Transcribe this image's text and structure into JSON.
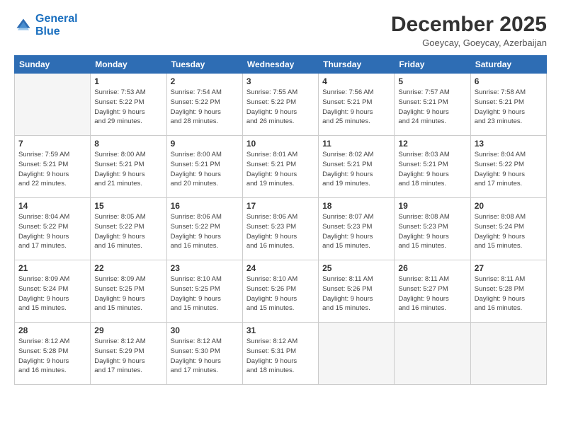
{
  "logo": {
    "line1": "General",
    "line2": "Blue"
  },
  "title": "December 2025",
  "subtitle": "Goeycay, Goeycay, Azerbaijan",
  "headers": [
    "Sunday",
    "Monday",
    "Tuesday",
    "Wednesday",
    "Thursday",
    "Friday",
    "Saturday"
  ],
  "weeks": [
    [
      {
        "day": "",
        "detail": ""
      },
      {
        "day": "1",
        "detail": "Sunrise: 7:53 AM\nSunset: 5:22 PM\nDaylight: 9 hours\nand 29 minutes."
      },
      {
        "day": "2",
        "detail": "Sunrise: 7:54 AM\nSunset: 5:22 PM\nDaylight: 9 hours\nand 28 minutes."
      },
      {
        "day": "3",
        "detail": "Sunrise: 7:55 AM\nSunset: 5:22 PM\nDaylight: 9 hours\nand 26 minutes."
      },
      {
        "day": "4",
        "detail": "Sunrise: 7:56 AM\nSunset: 5:21 PM\nDaylight: 9 hours\nand 25 minutes."
      },
      {
        "day": "5",
        "detail": "Sunrise: 7:57 AM\nSunset: 5:21 PM\nDaylight: 9 hours\nand 24 minutes."
      },
      {
        "day": "6",
        "detail": "Sunrise: 7:58 AM\nSunset: 5:21 PM\nDaylight: 9 hours\nand 23 minutes."
      }
    ],
    [
      {
        "day": "7",
        "detail": "Sunrise: 7:59 AM\nSunset: 5:21 PM\nDaylight: 9 hours\nand 22 minutes."
      },
      {
        "day": "8",
        "detail": "Sunrise: 8:00 AM\nSunset: 5:21 PM\nDaylight: 9 hours\nand 21 minutes."
      },
      {
        "day": "9",
        "detail": "Sunrise: 8:00 AM\nSunset: 5:21 PM\nDaylight: 9 hours\nand 20 minutes."
      },
      {
        "day": "10",
        "detail": "Sunrise: 8:01 AM\nSunset: 5:21 PM\nDaylight: 9 hours\nand 19 minutes."
      },
      {
        "day": "11",
        "detail": "Sunrise: 8:02 AM\nSunset: 5:21 PM\nDaylight: 9 hours\nand 19 minutes."
      },
      {
        "day": "12",
        "detail": "Sunrise: 8:03 AM\nSunset: 5:21 PM\nDaylight: 9 hours\nand 18 minutes."
      },
      {
        "day": "13",
        "detail": "Sunrise: 8:04 AM\nSunset: 5:22 PM\nDaylight: 9 hours\nand 17 minutes."
      }
    ],
    [
      {
        "day": "14",
        "detail": "Sunrise: 8:04 AM\nSunset: 5:22 PM\nDaylight: 9 hours\nand 17 minutes."
      },
      {
        "day": "15",
        "detail": "Sunrise: 8:05 AM\nSunset: 5:22 PM\nDaylight: 9 hours\nand 16 minutes."
      },
      {
        "day": "16",
        "detail": "Sunrise: 8:06 AM\nSunset: 5:22 PM\nDaylight: 9 hours\nand 16 minutes."
      },
      {
        "day": "17",
        "detail": "Sunrise: 8:06 AM\nSunset: 5:23 PM\nDaylight: 9 hours\nand 16 minutes."
      },
      {
        "day": "18",
        "detail": "Sunrise: 8:07 AM\nSunset: 5:23 PM\nDaylight: 9 hours\nand 15 minutes."
      },
      {
        "day": "19",
        "detail": "Sunrise: 8:08 AM\nSunset: 5:23 PM\nDaylight: 9 hours\nand 15 minutes."
      },
      {
        "day": "20",
        "detail": "Sunrise: 8:08 AM\nSunset: 5:24 PM\nDaylight: 9 hours\nand 15 minutes."
      }
    ],
    [
      {
        "day": "21",
        "detail": "Sunrise: 8:09 AM\nSunset: 5:24 PM\nDaylight: 9 hours\nand 15 minutes."
      },
      {
        "day": "22",
        "detail": "Sunrise: 8:09 AM\nSunset: 5:25 PM\nDaylight: 9 hours\nand 15 minutes."
      },
      {
        "day": "23",
        "detail": "Sunrise: 8:10 AM\nSunset: 5:25 PM\nDaylight: 9 hours\nand 15 minutes."
      },
      {
        "day": "24",
        "detail": "Sunrise: 8:10 AM\nSunset: 5:26 PM\nDaylight: 9 hours\nand 15 minutes."
      },
      {
        "day": "25",
        "detail": "Sunrise: 8:11 AM\nSunset: 5:26 PM\nDaylight: 9 hours\nand 15 minutes."
      },
      {
        "day": "26",
        "detail": "Sunrise: 8:11 AM\nSunset: 5:27 PM\nDaylight: 9 hours\nand 16 minutes."
      },
      {
        "day": "27",
        "detail": "Sunrise: 8:11 AM\nSunset: 5:28 PM\nDaylight: 9 hours\nand 16 minutes."
      }
    ],
    [
      {
        "day": "28",
        "detail": "Sunrise: 8:12 AM\nSunset: 5:28 PM\nDaylight: 9 hours\nand 16 minutes."
      },
      {
        "day": "29",
        "detail": "Sunrise: 8:12 AM\nSunset: 5:29 PM\nDaylight: 9 hours\nand 17 minutes."
      },
      {
        "day": "30",
        "detail": "Sunrise: 8:12 AM\nSunset: 5:30 PM\nDaylight: 9 hours\nand 17 minutes."
      },
      {
        "day": "31",
        "detail": "Sunrise: 8:12 AM\nSunset: 5:31 PM\nDaylight: 9 hours\nand 18 minutes."
      },
      {
        "day": "",
        "detail": ""
      },
      {
        "day": "",
        "detail": ""
      },
      {
        "day": "",
        "detail": ""
      }
    ]
  ]
}
